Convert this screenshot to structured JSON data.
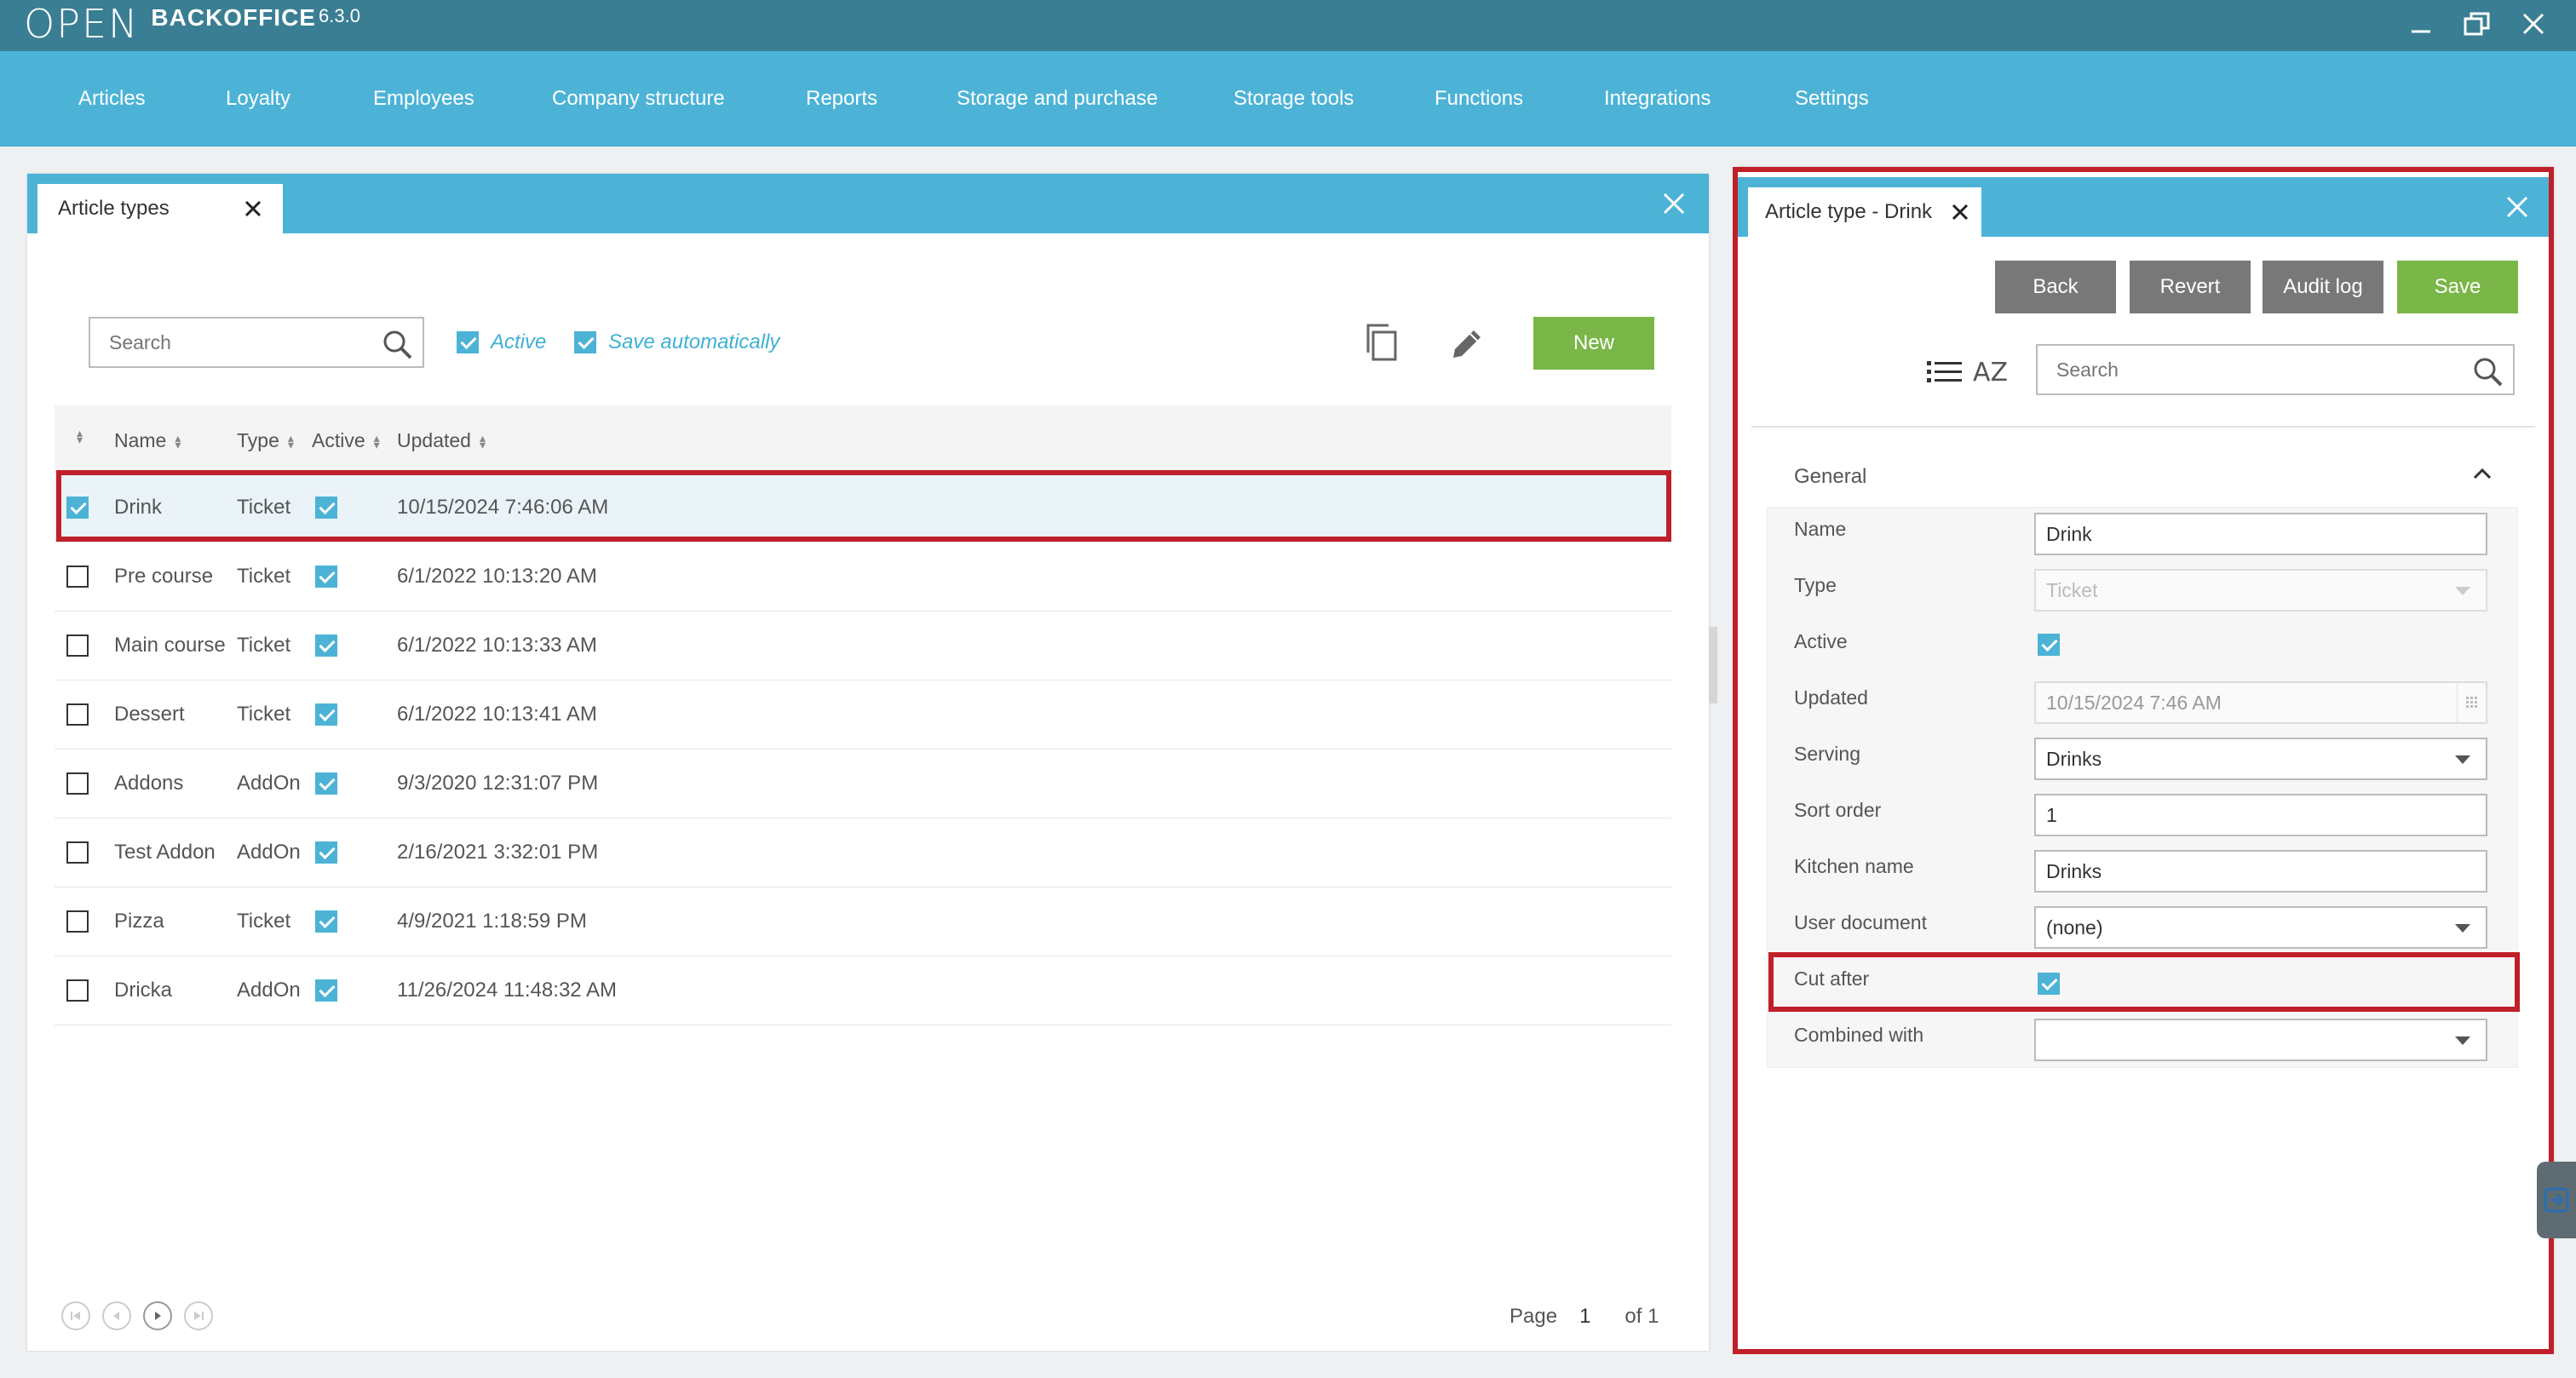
{
  "app": {
    "logo_mark": "OPEN",
    "logo_text": "BACKOFFICE",
    "version": "6.3.0"
  },
  "nav": {
    "items": [
      "Articles",
      "Loyalty",
      "Employees",
      "Company structure",
      "Reports",
      "Storage and purchase",
      "Storage tools",
      "Functions",
      "Integrations",
      "Settings"
    ]
  },
  "left_panel": {
    "tab_label": "Article types",
    "search_placeholder": "Search",
    "active_label": "Active",
    "save_auto_label": "Save automatically",
    "new_label": "New",
    "columns": [
      "Name",
      "Type",
      "Active",
      "Updated"
    ],
    "rows": [
      {
        "name": "Drink",
        "type": "Ticket",
        "updated": "10/15/2024 7:46:06 AM"
      },
      {
        "name": "Pre course",
        "type": "Ticket",
        "updated": "6/1/2022 10:13:20 AM"
      },
      {
        "name": "Main course",
        "type": "Ticket",
        "updated": "6/1/2022 10:13:33 AM"
      },
      {
        "name": "Dessert",
        "type": "Ticket",
        "updated": "6/1/2022 10:13:41 AM"
      },
      {
        "name": "Addons",
        "type": "AddOn",
        "updated": "9/3/2020 12:31:07 PM"
      },
      {
        "name": "Test Addon",
        "type": "AddOn",
        "updated": "2/16/2021 3:32:01 PM"
      },
      {
        "name": "Pizza",
        "type": "Ticket",
        "updated": "4/9/2021 1:18:59 PM"
      },
      {
        "name": "Dricka",
        "type": "AddOn",
        "updated": "11/26/2024 11:48:32 AM"
      }
    ],
    "pager": {
      "page_label": "Page",
      "page": "1",
      "of_label": "of 1"
    }
  },
  "right_panel": {
    "tab_label": "Article type - Drink",
    "buttons": {
      "back": "Back",
      "revert": "Revert",
      "audit": "Audit log",
      "save": "Save"
    },
    "search_placeholder": "Search",
    "sort_label": "AZ",
    "section": "General",
    "fields": {
      "name": {
        "label": "Name",
        "value": "Drink"
      },
      "type": {
        "label": "Type",
        "value": "Ticket"
      },
      "active": {
        "label": "Active"
      },
      "updated": {
        "label": "Updated",
        "value": "10/15/2024 7:46 AM"
      },
      "serving": {
        "label": "Serving",
        "value": "Drinks"
      },
      "sort_order": {
        "label": "Sort order",
        "value": "1"
      },
      "kitchen_name": {
        "label": "Kitchen name",
        "value": "Drinks"
      },
      "user_document": {
        "label": "User document",
        "value": "(none)"
      },
      "cut_after": {
        "label": "Cut after"
      },
      "combined_with": {
        "label": "Combined with",
        "value": ""
      }
    }
  },
  "colors": {
    "accent": "#4cb3d6",
    "titlebar": "#3a7e93",
    "green": "#7ab648",
    "highlight": "#c0202a"
  }
}
